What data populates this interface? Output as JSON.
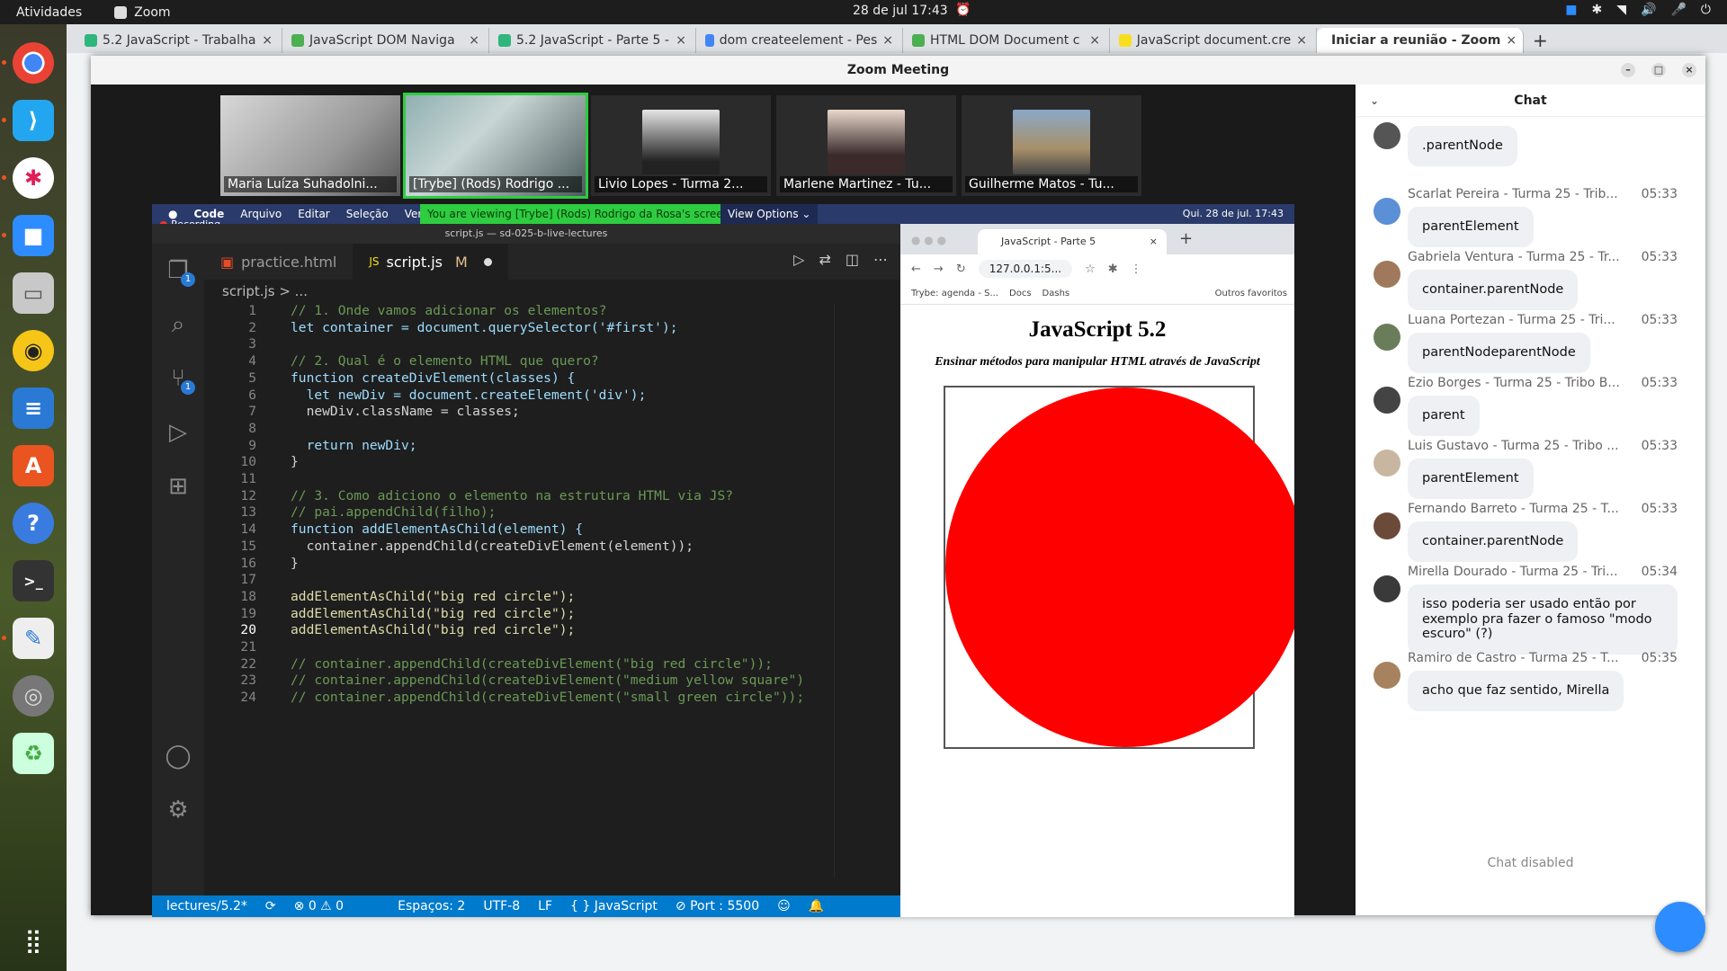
{
  "topbar": {
    "activities": "Atividades",
    "app_name": "Zoom",
    "clock": "28 de jul  17:43"
  },
  "browser_tabs": [
    {
      "label": "5.2 JavaScript - Trabalha",
      "color": "#2fb67c"
    },
    {
      "label": "JavaScript DOM Naviga",
      "color": "#4caf50"
    },
    {
      "label": "5.2 JavaScript - Parte 5 -",
      "color": "#2fb67c"
    },
    {
      "label": "dom createelement - Pes",
      "color": "#4285f4"
    },
    {
      "label": "HTML DOM Document c",
      "color": "#4caf50"
    },
    {
      "label": "JavaScript document.cre",
      "color": "#f7df1e"
    },
    {
      "label": "Iniciar a reunião - Zoom",
      "color": "#2d8cff"
    }
  ],
  "zoom": {
    "title": "Zoom Meeting",
    "participants": [
      {
        "name": "Maria Luíza Suhadolni..."
      },
      {
        "name": "[Trybe]  (Rods) Rodrigo ..."
      },
      {
        "name": "Livio Lopes - Turma 2..."
      },
      {
        "name": "Marlene Martinez - Tu..."
      },
      {
        "name": "Guilherme Matos - Tu..."
      }
    ]
  },
  "share": {
    "recording": "Recording",
    "mac_menu": [
      "Code",
      "Arquivo",
      "Editar",
      "Seleção",
      "Ver"
    ],
    "viewing": "You are viewing [Trybe]  (Rods) Rodrigo da Rosa's screen",
    "view_options": "View Options ⌄",
    "mac_clock": "Qui. 28 de jul.  17:43"
  },
  "vscode": {
    "title": "script.js — sd-025-b-live-lectures",
    "tabs": [
      {
        "label": "practice.html",
        "icon": "html-icon"
      },
      {
        "label": "script.js",
        "icon": "js-icon",
        "modified": "M"
      }
    ],
    "breadcrumb": "script.js > ...",
    "lines": [
      "// 1. Onde vamos adicionar os elementos?",
      "let container = document.querySelector('#first');",
      "",
      "// 2. Qual é o elemento HTML que quero?",
      "function createDivElement(classes) {",
      "  let newDiv = document.createElement('div');",
      "  newDiv.className = classes;",
      "",
      "  return newDiv;",
      "}",
      "",
      "// 3. Como adiciono o elemento na estrutura HTML via JS?",
      "// pai.appendChild(filho);",
      "function addElementAsChild(element) {",
      "  container.appendChild(createDivElement(element));",
      "}",
      "",
      "addElementAsChild(\"big red circle\");",
      "addElementAsChild(\"big red circle\");",
      "addElementAsChild(\"big red circle\");",
      "",
      "// container.appendChild(createDivElement(\"big red circle\"));",
      "// container.appendChild(createDivElement(\"medium yellow square\")",
      "// container.appendChild(createDivElement(\"small green circle\"));"
    ],
    "current_line": 20,
    "status": {
      "branch": "lectures/5.2*",
      "problems": "⊗ 0 ⚠ 0",
      "spaces": "Espaços: 2",
      "encoding": "UTF-8",
      "eol": "LF",
      "language": "{ } JavaScript",
      "port": "⊘ Port : 5500"
    }
  },
  "inner_browser": {
    "tab_title": "JavaScript - Parte 5",
    "url": "127.0.0.1:5...",
    "bookmarks": [
      "Trybe: agenda - S...",
      "Docs",
      "Dashs",
      "Outros favoritos"
    ],
    "page_title": "JavaScript 5.2",
    "page_subtitle": "Ensinar métodos para manipular HTML através de JavaScript",
    "circle_color": "#ff0000"
  },
  "chat": {
    "title": "Chat",
    "messages": [
      {
        "sender": "",
        "time": "",
        "text": ".parentNode"
      },
      {
        "sender": "Scarlat Pereira - Turma 25 - Trib...",
        "time": "05:33",
        "text": "parentElement"
      },
      {
        "sender": "Gabriela Ventura - Turma 25 - Tr...",
        "time": "05:33",
        "text": "container.parentNode"
      },
      {
        "sender": "Luana Portezan - Turma 25 - Tri...",
        "time": "05:33",
        "text": "parentNodeparentNode"
      },
      {
        "sender": "Ézio Borges - Turma 25 - Tribo B...",
        "time": "05:33",
        "text": "parent"
      },
      {
        "sender": "Luis Gustavo - Turma 25 - Tribo ...",
        "time": "05:33",
        "text": "parentElement"
      },
      {
        "sender": "Fernando Barreto - Turma 25 - T...",
        "time": "05:33",
        "text": "container.parentNode"
      },
      {
        "sender": "Mirella Dourado - Turma 25 - Tri...",
        "time": "05:34",
        "text": "isso poderia ser usado então por exemplo pra fazer o famoso \"modo escuro\" (?)"
      },
      {
        "sender": "Ramiro de Castro - Turma 25 - T...",
        "time": "05:35",
        "text": "acho que faz sentido, Mirella"
      }
    ],
    "disabled_text": "Chat disabled"
  }
}
